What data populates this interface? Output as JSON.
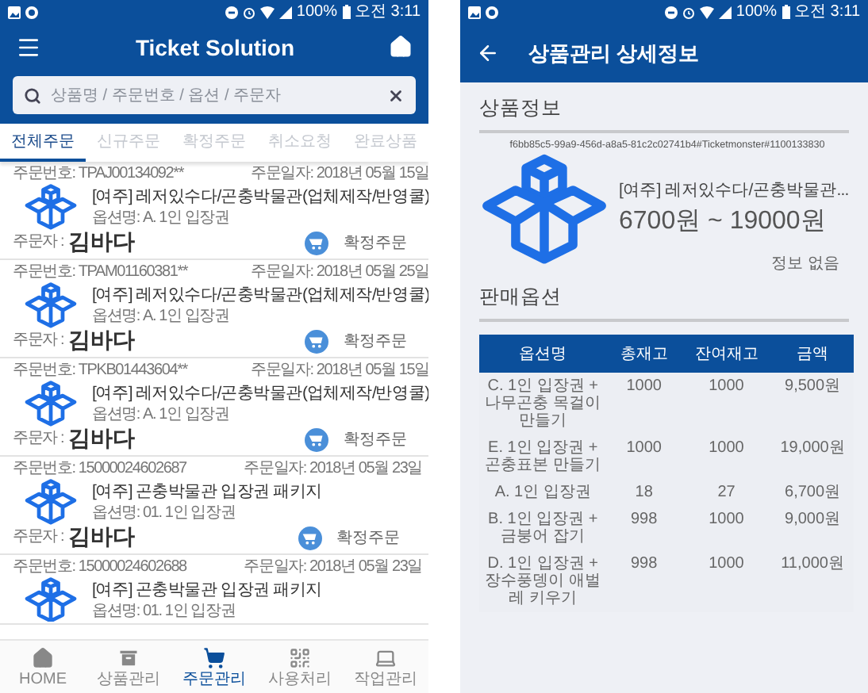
{
  "order_screen": {
    "status_bar": {
      "battery": "100%",
      "time": "오전 3:11"
    },
    "title": "Ticket Solution",
    "search": {
      "placeholder": "상품명 / 주문번호 / 옵션 / 주문자"
    },
    "tabs": [
      {
        "label": "전체주문",
        "selected": true
      },
      {
        "label": "신규주문",
        "selected": false
      },
      {
        "label": "확정주문",
        "selected": false
      },
      {
        "label": "취소요청",
        "selected": false
      },
      {
        "label": "완료상품",
        "selected": false
      }
    ],
    "orders": [
      {
        "order_number": "주문번호: TPAJ00134092**",
        "order_date": "주문일자: 2018년 05월 15일",
        "title": "[여주] 레저있수다/곤충박물관(업체제작/반영쿨)",
        "option": "옵션명: A. 1인 입장권",
        "orderer_label": "주문자 :",
        "orderer": "김바다",
        "status": "확정주문"
      },
      {
        "order_number": "주문번호: TPAM01160381**",
        "order_date": "주문일자: 2018년 05월 25일",
        "title": "[여주] 레저있수다/곤충박물관(업체제작/반영쿨)",
        "option": "옵션명: A. 1인 입장권",
        "orderer_label": "주문자 :",
        "orderer": "김바다",
        "status": "확정주문"
      },
      {
        "order_number": "주문번호: TPKB01443604**",
        "order_date": "주문일자: 2018년 05월 15일",
        "title": "[여주] 레저있수다/곤충박물관(업체제작/반영쿨)",
        "option": "옵션명: A. 1인 입장권",
        "orderer_label": "주문자 :",
        "orderer": "김바다",
        "status": "확정주문"
      },
      {
        "order_number": "주문번호: 15000024602687",
        "order_date": "주문일자: 2018년 05월 23일",
        "title": "[여주] 곤충박물관 입장권 패키지",
        "option": "옵션명: 01. 1인 입장권",
        "orderer_label": "주문자 :",
        "orderer": "김바다",
        "status": "확정주문"
      },
      {
        "order_number": "주문번호: 15000024602688",
        "order_date": "주문일자: 2018년 05월 23일",
        "title": "[여주] 곤충박물관 입장권 패키지",
        "option": "옵션명: 01. 1인 입장권"
      }
    ],
    "nav": [
      {
        "label": "HOME",
        "kind": "home",
        "selected": false
      },
      {
        "label": "상품관리",
        "kind": "archive",
        "selected": false
      },
      {
        "label": "주문관리",
        "kind": "cart",
        "selected": true
      },
      {
        "label": "사용처리",
        "kind": "qr",
        "selected": false
      },
      {
        "label": "작업관리",
        "kind": "laptop",
        "selected": false
      }
    ]
  },
  "detail_screen": {
    "status_bar": {
      "battery": "100%",
      "time": "오전 3:11"
    },
    "title": "상품관리 상세정보",
    "section": "상품정보",
    "product_id": "f6bb85c5-99a9-456d-a8a5-81c2c02741b4#Ticketmonster#1100133830",
    "product_name": "[여주] 레저있수다/곤충박물관...",
    "price": "6700원 ~ 19000원",
    "note": "정보 없음",
    "options_heading": "판매옵션",
    "table": {
      "columns": [
        "옵션명",
        "총재고",
        "잔여재고",
        "금액"
      ],
      "rows": [
        [
          "C. 1인 입장권 + 나무곤충 목걸이 만들기",
          "1000",
          "1000",
          "9,500원"
        ],
        [
          "E. 1인 입장권 + 곤충표본 만들기",
          "1000",
          "1000",
          "19,000원"
        ],
        [
          "A. 1인 입장권",
          "18",
          "27",
          "6,700원"
        ],
        [
          "B. 1인 입장권 + 금붕어 잡기",
          "998",
          "1000",
          "9,000원"
        ],
        [
          "D. 1인 입장권 + 장수풍뎅이 애벌레 키우기",
          "998",
          "1000",
          "11,000원"
        ]
      ]
    }
  }
}
